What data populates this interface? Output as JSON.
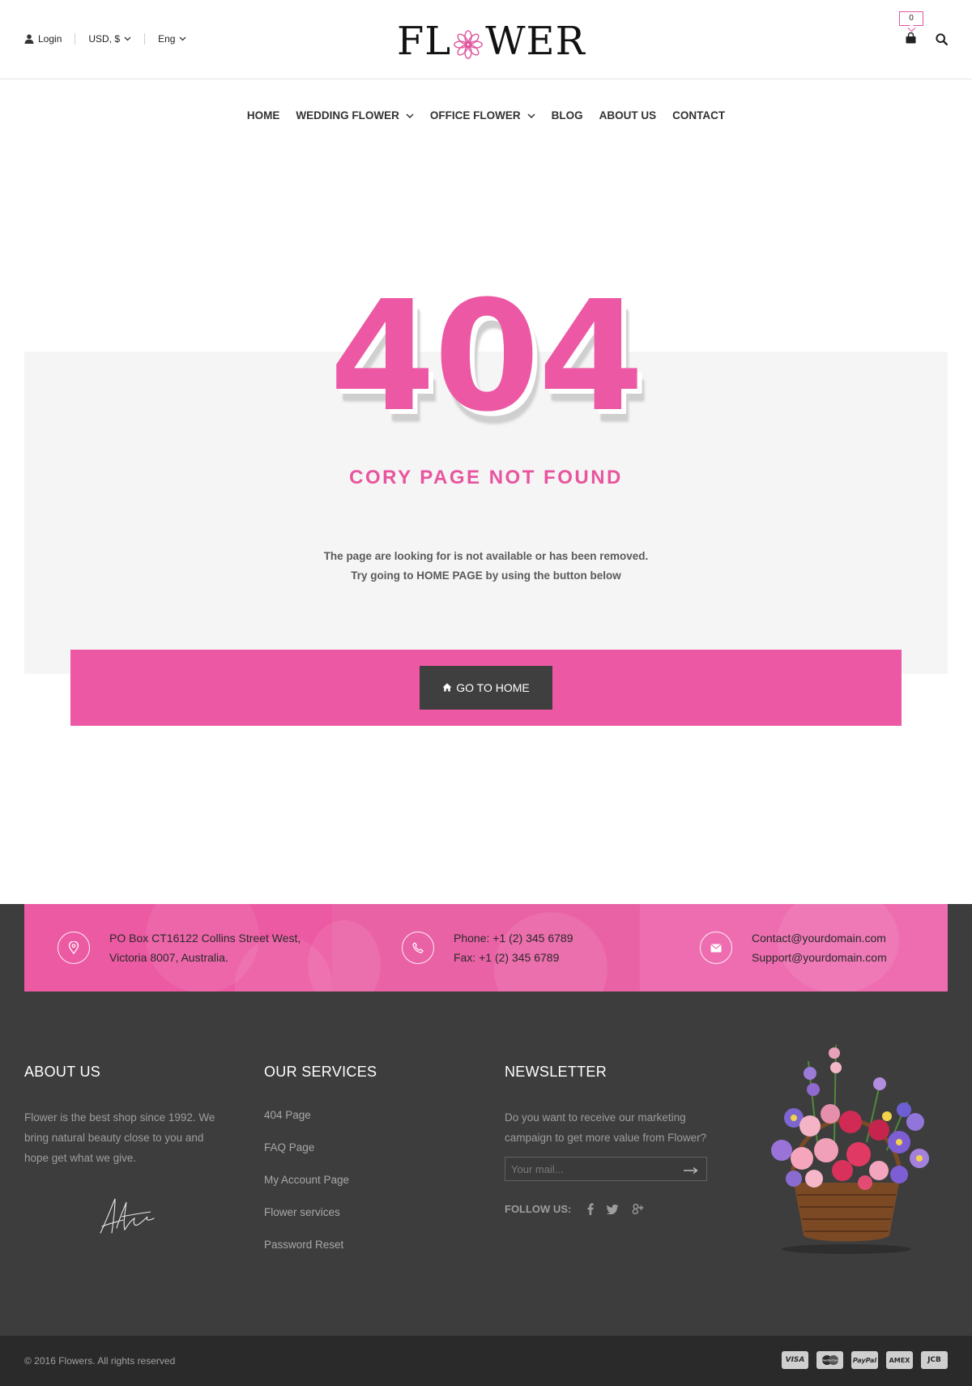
{
  "header": {
    "login_label": "Login",
    "currency_label": "USD, $",
    "language_label": "Eng",
    "logo_left": "FL",
    "logo_right": "WER",
    "cart_count": "0",
    "accent_color": "#ec58a3"
  },
  "nav": {
    "items": [
      {
        "label": "HOME",
        "has_dropdown": false
      },
      {
        "label": "WEDDING FLOWER",
        "has_dropdown": true
      },
      {
        "label": "OFFICE FLOWER",
        "has_dropdown": true
      },
      {
        "label": "BLOG",
        "has_dropdown": false
      },
      {
        "label": "ABOUT US",
        "has_dropdown": false
      },
      {
        "label": "CONTACT",
        "has_dropdown": false
      }
    ]
  },
  "error": {
    "code": "404",
    "title": "CORY PAGE NOT FOUND",
    "line1": "The page are looking for is not available or has been removed.",
    "line2": "Try going to HOME PAGE by using the button below",
    "button_label": "GO TO HOME"
  },
  "contact": {
    "address_line1": "PO Box CT16122 Collins Street West,",
    "address_line2": "Victoria 8007, Australia.",
    "phone": "Phone: +1 (2) 345 6789",
    "fax": "Fax: +1 (2) 345 6789",
    "email1": "Contact@yourdomain.com",
    "email2": "Support@yourdomain.com"
  },
  "footer": {
    "about_title": "ABOUT US",
    "about_text": "Flower is the best shop since 1992. We bring natural beauty close to you and hope get what we give.",
    "services_title": "OUR SERVICES",
    "services": [
      "404 Page",
      "FAQ Page",
      "My Account Page",
      "Flower services",
      "Password Reset"
    ],
    "newsletter_title": "NEWSLETTER",
    "newsletter_text": "Do you want to receive our marketing campaign to get more value from Flower?",
    "newsletter_placeholder": "Your mail...",
    "follow_label": "FOLLOW US:",
    "social_icons": [
      "facebook-icon",
      "twitter-icon",
      "google-plus-icon"
    ]
  },
  "bottom": {
    "copyright": "© 2016 Flowers. All rights reserved",
    "payment_cards": [
      "VISA",
      "MasterCard",
      "PayPal",
      "AMEX",
      "JCB"
    ]
  }
}
